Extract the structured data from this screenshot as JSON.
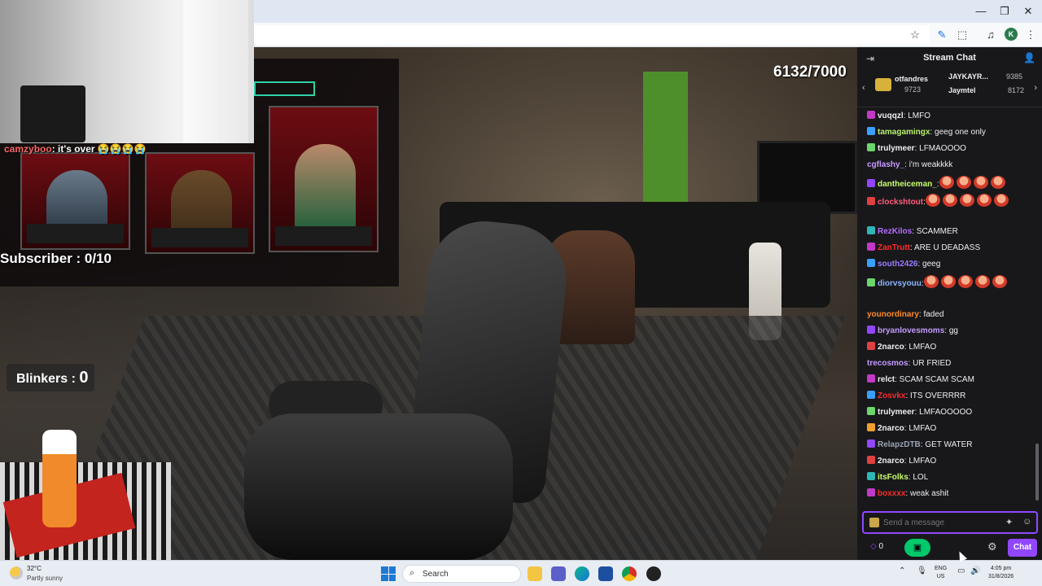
{
  "browser": {
    "window_controls": {
      "minimize": "—",
      "restore": "❐",
      "close": "✕"
    },
    "toolbar_icons": {
      "bookmark": "☆",
      "extension_1": "✎",
      "extensions": "⬚",
      "media": "♫",
      "menu": "⋮"
    },
    "profile_initial": "K"
  },
  "stream": {
    "counter": "6132/7000",
    "quote_user": "camzyboo",
    "quote_text": ": it's over 😭😭😭😭",
    "subscriber_label": "Subscriber : 0/10",
    "blinkers_label": "Blinkers : ",
    "blinkers_value": "0"
  },
  "chat": {
    "title": "Stream Chat",
    "leaderboard": [
      {
        "name": "otfandres",
        "score": "9723"
      },
      {
        "name": "JAYKAYR...",
        "score": "9385"
      },
      {
        "name": "Jaymtel",
        "score": "8172"
      }
    ],
    "messages": [
      {
        "user": "vuqqzl",
        "color": "#efeff1",
        "text": ": LMFO"
      },
      {
        "user": "tamagamingx",
        "color": "#b6f06a",
        "text": ": geeg one only"
      },
      {
        "user": "trulymeer",
        "color": "#efeff1",
        "text": ": LFMAOOOO"
      },
      {
        "user": "cgflashy_",
        "color": "#c59bff",
        "text": ": i'm weakkkk"
      },
      {
        "user": "dantheiceman_",
        "color": "#c7ff6a",
        "text": ":"
      },
      {
        "user": "clockshtout",
        "color": "#ff5d7a",
        "text": ":"
      },
      {
        "user": "RezKilos",
        "color": "#b66cff",
        "text": ": SCAMMER"
      },
      {
        "user": "ZanTrutt",
        "color": "#ff2a2a",
        "text": ": ARE U DEADASS"
      },
      {
        "user": "south2426",
        "color": "#9a7cff",
        "text": ": geeg"
      },
      {
        "user": "diorvsyouu",
        "color": "#8ab6ff",
        "text": ":"
      },
      {
        "user": "younordinary",
        "color": "#ff8a2a",
        "text": ": faded"
      },
      {
        "user": "bryanlovesmoms",
        "color": "#c59bff",
        "text": ": gg"
      },
      {
        "user": "2narco",
        "color": "#efeff1",
        "text": ": LMFAO"
      },
      {
        "user": "trecosmos",
        "color": "#c59bff",
        "text": ": UR FRIED"
      },
      {
        "user": "relct",
        "color": "#efeff1",
        "text": ": SCAM SCAM SCAM"
      },
      {
        "user": "Zosvkx",
        "color": "#ff2a2a",
        "text": ": ITS OVERRRR"
      },
      {
        "user": "trulymeer",
        "color": "#efeff1",
        "text": ": LMFAOOOOO"
      },
      {
        "user": "2narco",
        "color": "#efeff1",
        "text": ": LMFAO"
      },
      {
        "user": "RelapzDTB",
        "color": "#9aa4b3",
        "text": ": GET WATER"
      },
      {
        "user": "2narco",
        "color": "#efeff1",
        "text": ": LMFAO"
      },
      {
        "user": "itsFolks",
        "color": "#c7ff6a",
        "text": ": LOL"
      },
      {
        "user": "boxxxx",
        "color": "#ff2a2a",
        "text": ": weak ashit"
      }
    ],
    "input_placeholder": "Send a message",
    "points": "0",
    "chat_button": "Chat"
  },
  "taskbar": {
    "temp": "32°C",
    "weather": "Partly sunny",
    "search": "Search",
    "lang_1": "ENG",
    "lang_2": "US",
    "time": "4:05 pm",
    "date": "31/8/2026"
  },
  "colors": {
    "accent": "#9147ff",
    "gift": "#00c86b",
    "chat_bg": "#18181b"
  }
}
